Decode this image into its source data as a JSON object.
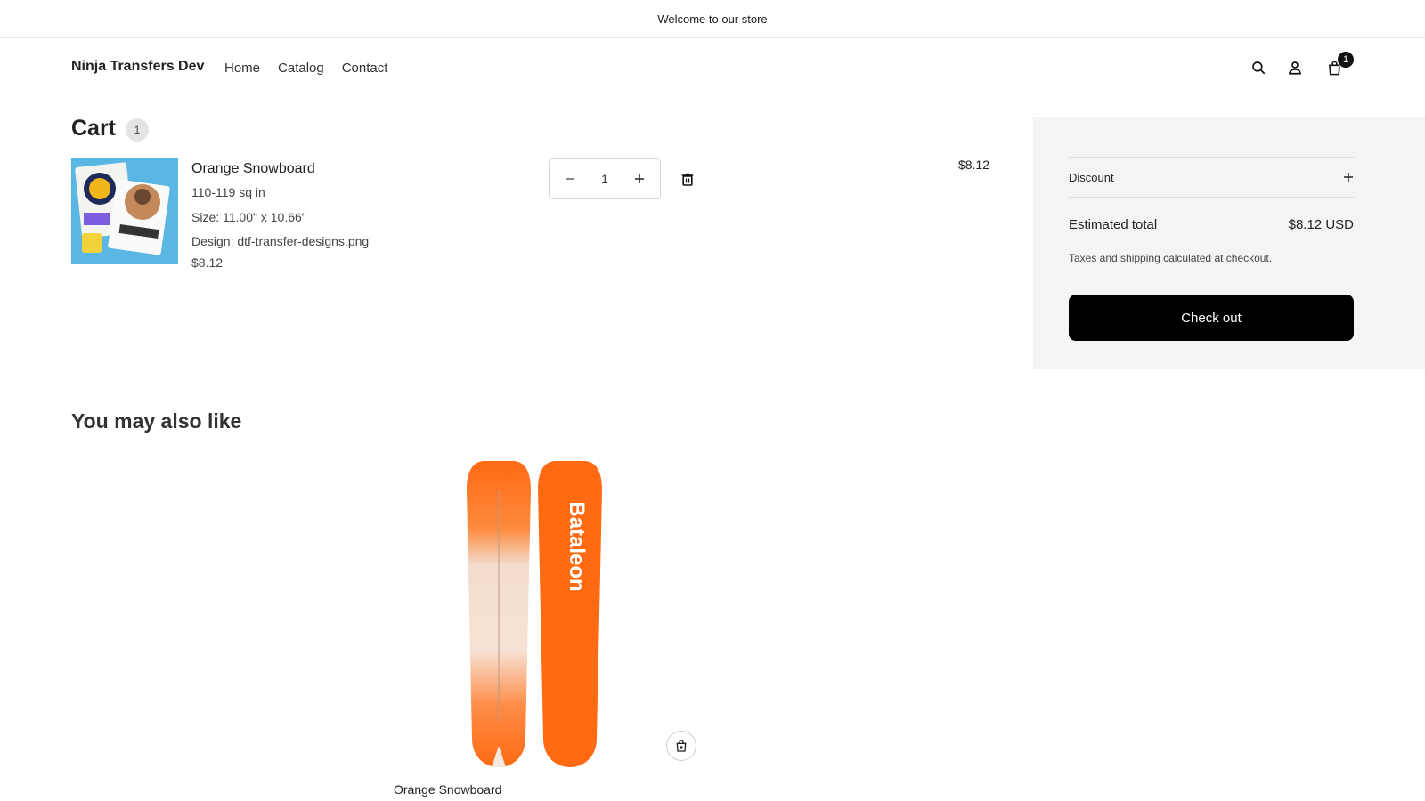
{
  "announcement": "Welcome to our store",
  "header": {
    "logo": "Ninja Transfers Dev",
    "nav": [
      "Home",
      "Catalog",
      "Contact"
    ],
    "cart_count": "1"
  },
  "cart": {
    "title": "Cart",
    "count": "1",
    "item": {
      "name": "Orange Snowboard",
      "variant": "110-119 sq in",
      "size": "Size: 11.00\" x 10.66\"",
      "design": "Design: dtf-transfer-designs.png",
      "unit_price": "$8.12",
      "quantity": "1",
      "line_price": "$8.12"
    }
  },
  "summary": {
    "discount_label": "Discount",
    "estimated_label": "Estimated total",
    "estimated_value": "$8.12 USD",
    "tax_note": "Taxes and shipping calculated at checkout.",
    "checkout_label": "Check out"
  },
  "recommendations": {
    "title": "You may also like",
    "product_name": "Orange Snowboard",
    "board_brand": "Bataleon"
  },
  "colors": {
    "accent": "#000000",
    "summary_bg": "#f4f4f4",
    "board_orange": "#ff6a13"
  },
  "icons": [
    "search-icon",
    "account-icon",
    "cart-icon",
    "minus-icon",
    "plus-icon",
    "trash-icon",
    "quick-add-icon"
  ]
}
